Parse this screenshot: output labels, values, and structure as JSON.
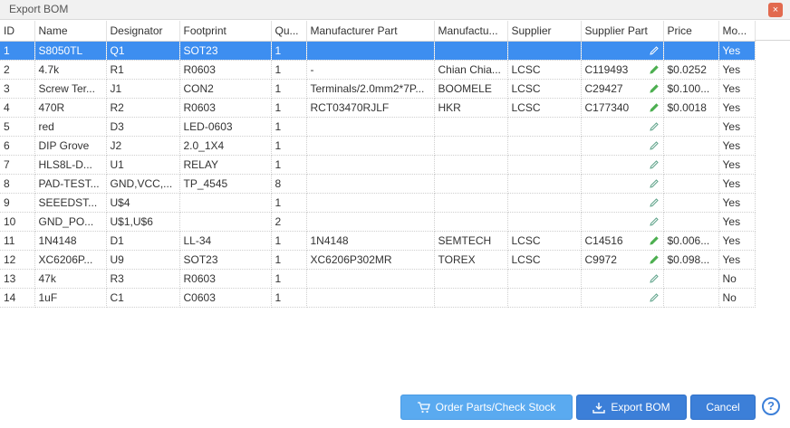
{
  "dialog": {
    "title": "Export BOM",
    "close_label": "×"
  },
  "columns": [
    "ID",
    "Name",
    "Designator",
    "Footprint",
    "Qu...",
    "Manufacturer Part",
    "Manufactu...",
    "Supplier",
    "Supplier Part",
    "Price",
    "Mo..."
  ],
  "rows": [
    {
      "id": "1",
      "name": "S8050TL",
      "designator": "Q1",
      "footprint": "SOT23",
      "qty": "1",
      "mfr_part": "",
      "manufacturer": "",
      "supplier": "",
      "supplier_part": "",
      "price": "",
      "mo": "Yes",
      "pen": "outline",
      "selected": true
    },
    {
      "id": "2",
      "name": "4.7k",
      "designator": "R1",
      "footprint": "R0603",
      "qty": "1",
      "mfr_part": "-",
      "manufacturer": "Chian Chia...",
      "supplier": "LCSC",
      "supplier_part": "C119493",
      "price": "$0.0252",
      "mo": "Yes",
      "pen": "filled",
      "selected": false
    },
    {
      "id": "3",
      "name": "Screw Ter...",
      "designator": "J1",
      "footprint": "CON2",
      "qty": "1",
      "mfr_part": "Terminals/2.0mm2*7P...",
      "manufacturer": "BOOMELE",
      "supplier": "LCSC",
      "supplier_part": "C29427",
      "price": "$0.100...",
      "mo": "Yes",
      "pen": "filled",
      "selected": false
    },
    {
      "id": "4",
      "name": "470R",
      "designator": "R2",
      "footprint": "R0603",
      "qty": "1",
      "mfr_part": "RCT03470RJLF",
      "manufacturer": "HKR",
      "supplier": "LCSC",
      "supplier_part": "C177340",
      "price": "$0.0018",
      "mo": "Yes",
      "pen": "filled",
      "selected": false
    },
    {
      "id": "5",
      "name": "red",
      "designator": "D3",
      "footprint": "LED-0603",
      "qty": "1",
      "mfr_part": "",
      "manufacturer": "",
      "supplier": "",
      "supplier_part": "",
      "price": "",
      "mo": "Yes",
      "pen": "outline",
      "selected": false
    },
    {
      "id": "6",
      "name": "DIP Grove",
      "designator": "J2",
      "footprint": "2.0_1X4",
      "qty": "1",
      "mfr_part": "",
      "manufacturer": "",
      "supplier": "",
      "supplier_part": "",
      "price": "",
      "mo": "Yes",
      "pen": "outline",
      "selected": false
    },
    {
      "id": "7",
      "name": "HLS8L-D...",
      "designator": "U1",
      "footprint": "RELAY",
      "qty": "1",
      "mfr_part": "",
      "manufacturer": "",
      "supplier": "",
      "supplier_part": "",
      "price": "",
      "mo": "Yes",
      "pen": "outline",
      "selected": false
    },
    {
      "id": "8",
      "name": "PAD-TEST...",
      "designator": "GND,VCC,...",
      "footprint": "TP_4545",
      "qty": "8",
      "mfr_part": "",
      "manufacturer": "",
      "supplier": "",
      "supplier_part": "",
      "price": "",
      "mo": "Yes",
      "pen": "outline",
      "selected": false
    },
    {
      "id": "9",
      "name": "SEEEDST...",
      "designator": "U$4",
      "footprint": "",
      "qty": "1",
      "mfr_part": "",
      "manufacturer": "",
      "supplier": "",
      "supplier_part": "",
      "price": "",
      "mo": "Yes",
      "pen": "outline",
      "selected": false
    },
    {
      "id": "10",
      "name": "GND_PO...",
      "designator": "U$1,U$6",
      "footprint": "",
      "qty": "2",
      "mfr_part": "",
      "manufacturer": "",
      "supplier": "",
      "supplier_part": "",
      "price": "",
      "mo": "Yes",
      "pen": "outline",
      "selected": false
    },
    {
      "id": "11",
      "name": "1N4148",
      "designator": "D1",
      "footprint": "LL-34",
      "qty": "1",
      "mfr_part": "1N4148",
      "manufacturer": "SEMTECH",
      "supplier": "LCSC",
      "supplier_part": "C14516",
      "price": "$0.006...",
      "mo": "Yes",
      "pen": "filled",
      "selected": false
    },
    {
      "id": "12",
      "name": "XC6206P...",
      "designator": "U9",
      "footprint": "SOT23",
      "qty": "1",
      "mfr_part": "XC6206P302MR",
      "manufacturer": "TOREX",
      "supplier": "LCSC",
      "supplier_part": "C9972",
      "price": "$0.098...",
      "mo": "Yes",
      "pen": "filled",
      "selected": false
    },
    {
      "id": "13",
      "name": "47k",
      "designator": "R3",
      "footprint": "R0603",
      "qty": "1",
      "mfr_part": "",
      "manufacturer": "",
      "supplier": "",
      "supplier_part": "",
      "price": "",
      "mo": "No",
      "pen": "outline",
      "selected": false
    },
    {
      "id": "14",
      "name": "1uF",
      "designator": "C1",
      "footprint": "C0603",
      "qty": "1",
      "mfr_part": "",
      "manufacturer": "",
      "supplier": "",
      "supplier_part": "",
      "price": "",
      "mo": "No",
      "pen": "outline",
      "selected": false
    }
  ],
  "buttons": {
    "order_label": "Order Parts/Check Stock",
    "export_label": "Export BOM",
    "cancel_label": "Cancel",
    "help_label": "?"
  },
  "colors": {
    "selected_row": "#3d8ef0",
    "primary_button": "#3c7fd8",
    "order_button": "#5aaaf0",
    "close_button": "#e26a4f",
    "pen_filled": "#4caf50"
  }
}
